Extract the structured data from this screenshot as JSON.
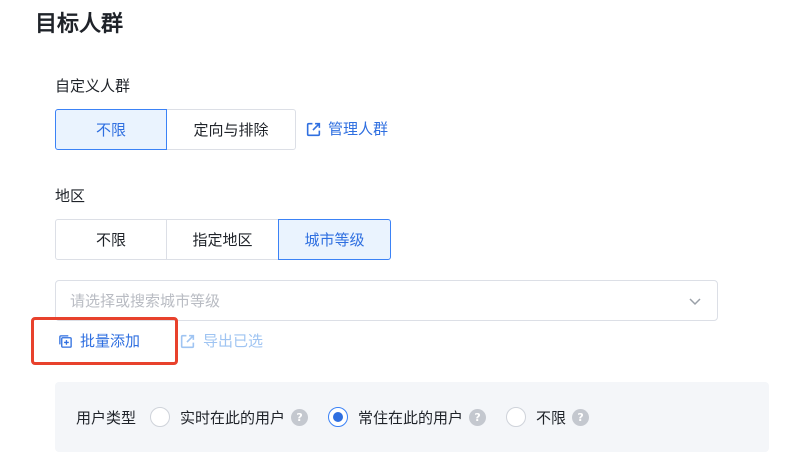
{
  "page_title": "目标人群",
  "custom_audience": {
    "label": "自定义人群",
    "options": [
      {
        "label": "不限",
        "active": true
      },
      {
        "label": "定向与排除",
        "active": false
      }
    ],
    "manage_link": "管理人群",
    "manage_icon": "external-link-icon"
  },
  "region": {
    "label": "地区",
    "options": [
      {
        "label": "不限",
        "active": false
      },
      {
        "label": "指定地区",
        "active": false
      },
      {
        "label": "城市等级",
        "active": true
      }
    ],
    "select_placeholder": "请选择或搜索城市等级",
    "dropdown_icon": "chevron-down-icon",
    "batch_add": "批量添加",
    "batch_add_icon": "add-copy-icon",
    "export_selected": "导出已选",
    "export_icon": "export-icon"
  },
  "user_type": {
    "label": "用户类型",
    "options": [
      {
        "label": "实时在此的用户",
        "checked": false,
        "help": "?"
      },
      {
        "label": "常住在此的用户",
        "checked": true,
        "help": "?"
      },
      {
        "label": "不限",
        "checked": false,
        "help": "?"
      }
    ]
  },
  "colors": {
    "primary": "#2f6fe0",
    "active_bg": "#eaf3fe",
    "highlight": "#e8412c",
    "disabled_link": "#9fc4f2",
    "panel_bg": "#f4f6f9"
  }
}
